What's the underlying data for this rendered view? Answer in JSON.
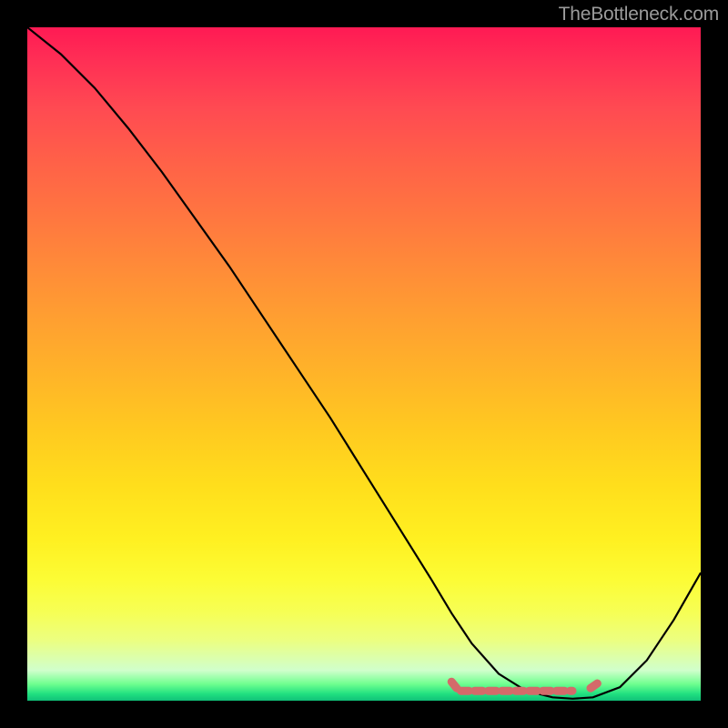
{
  "watermark": "TheBottleneck.com",
  "chart_data": {
    "type": "line",
    "title": "",
    "xlabel": "",
    "ylabel": "",
    "xlim": [
      0,
      100
    ],
    "ylim": [
      0,
      100
    ],
    "series": [
      {
        "name": "curve",
        "color": "#000000",
        "x": [
          0,
          5,
          10,
          15,
          20,
          25,
          30,
          35,
          40,
          45,
          50,
          55,
          60,
          63,
          66,
          70,
          74,
          78,
          81,
          84,
          88,
          92,
          96,
          100
        ],
        "y": [
          100,
          96,
          91,
          85,
          78.5,
          71.5,
          64.5,
          57,
          49.5,
          42,
          34,
          26,
          18,
          13,
          8.5,
          4,
          1.5,
          0.5,
          0.3,
          0.5,
          2,
          6,
          12,
          19
        ]
      }
    ],
    "optimal_band": {
      "color": "#d46a6a",
      "x": [
        63,
        85
      ],
      "y": [
        2,
        2
      ]
    }
  }
}
